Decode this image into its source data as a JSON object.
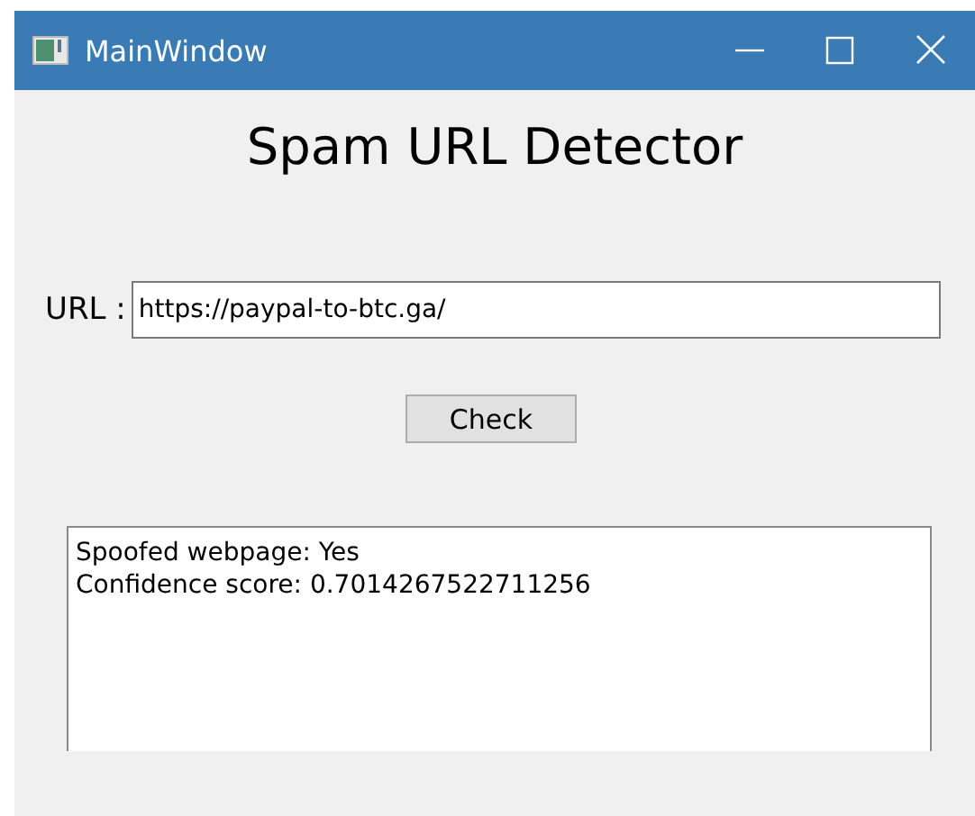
{
  "window": {
    "title": "MainWindow"
  },
  "heading": "Spam URL Detector",
  "url": {
    "label": "URL :",
    "value": "https://paypal-to-btc.ga/"
  },
  "check_button": "Check",
  "result": {
    "lines": [
      "Spoofed webpage: Yes",
      "Confidence score: 0.7014267522711256"
    ]
  }
}
